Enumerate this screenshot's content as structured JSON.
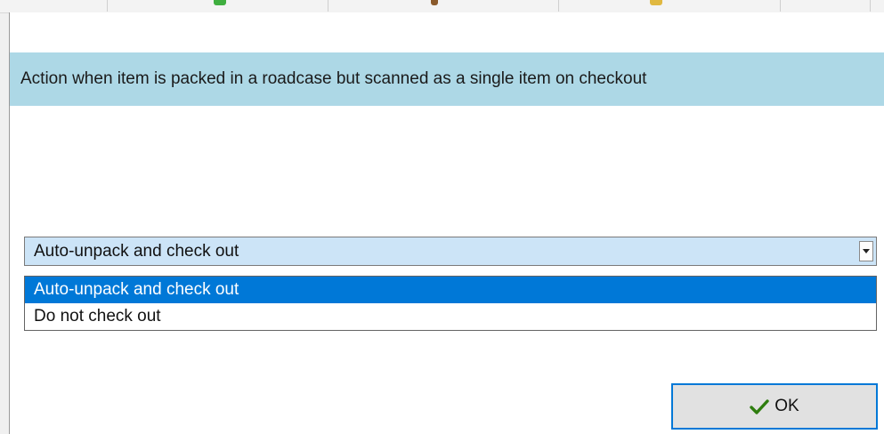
{
  "dialog": {
    "message": "Action when item is packed in a roadcase but scanned as a single item on checkout"
  },
  "dropdown": {
    "selected_value": "Auto-unpack and check out",
    "options": [
      "Auto-unpack and check out",
      "Do not check out"
    ],
    "highlighted_index": 0
  },
  "ok_button": {
    "label": "OK",
    "icon": "checkmark-icon"
  },
  "colors": {
    "message_band": "#add8e6",
    "combo_background": "#cce4f7",
    "selection": "#0078d7",
    "checkmark": "#2e7d0e"
  }
}
